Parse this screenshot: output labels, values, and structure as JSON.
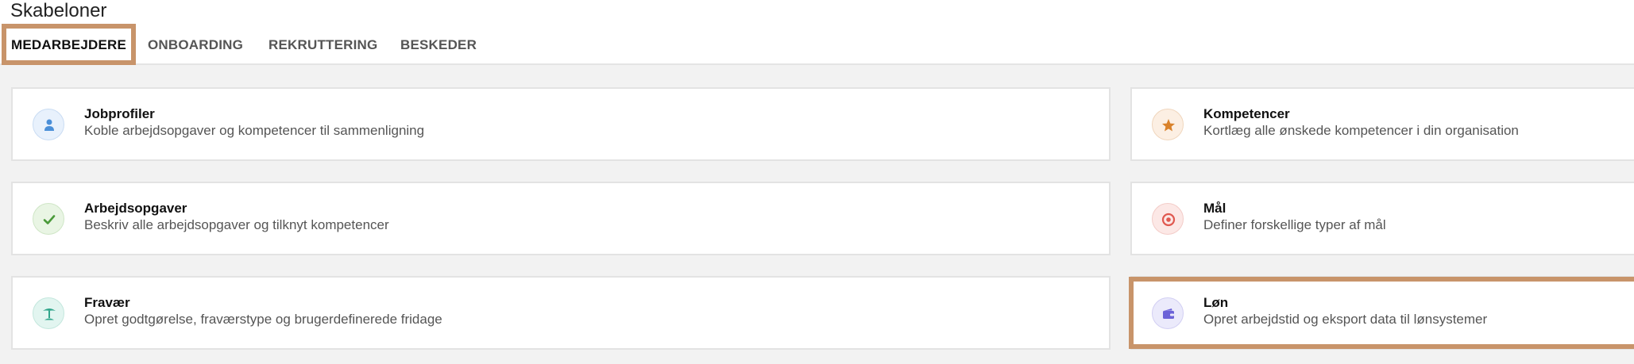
{
  "page": {
    "title": "Skabeloner"
  },
  "tabs": [
    {
      "label": "MEDARBEJDERE",
      "active": true
    },
    {
      "label": "ONBOARDING",
      "active": false
    },
    {
      "label": "REKRUTTERING",
      "active": false
    },
    {
      "label": "BESKEDER",
      "active": false
    }
  ],
  "cards": [
    {
      "title": "Jobprofiler",
      "description": "Koble arbejdsopgaver og kompetencer til sammenligning",
      "icon": "person-icon",
      "icon_color": "#4a8fd8",
      "icon_bg": "#e8f1fc"
    },
    {
      "title": "Kompetencer",
      "description": "Kortlæg alle ønskede kompetencer i din organisation",
      "icon": "star-icon",
      "icon_color": "#d9822b",
      "icon_bg": "#fcefe3"
    },
    {
      "title": "Arbejdsopgaver",
      "description": "Beskriv alle arbejdsopgaver og tilknyt kompetencer",
      "icon": "check-icon",
      "icon_color": "#4a9a3a",
      "icon_bg": "#e9f5e4"
    },
    {
      "title": "Mål",
      "description": "Definer forskellige typer af mål",
      "icon": "target-icon",
      "icon_color": "#e0584f",
      "icon_bg": "#fce8e6"
    },
    {
      "title": "Fravær",
      "description": "Opret godtgørelse, fraværstype og brugerdefinerede fridage",
      "icon": "palm-tree-icon",
      "icon_color": "#2fa58a",
      "icon_bg": "#e2f5f0"
    },
    {
      "title": "Løn",
      "description": "Opret arbejdstid og eksport data til lønsystemer",
      "icon": "wallet-icon",
      "icon_color": "#6c63d8",
      "icon_bg": "#ebeafb"
    }
  ],
  "colors": {
    "highlight": "#c8946a",
    "background": "#f2f2f2",
    "card_border": "#e3e3e3"
  }
}
